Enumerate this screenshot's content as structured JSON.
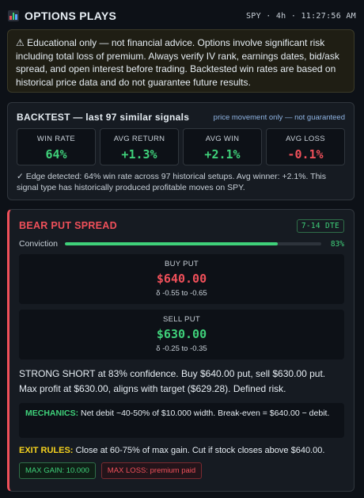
{
  "header": {
    "title": "OPTIONS PLAYS",
    "meta": "SPY · 4h · 11:27:56 AM",
    "icon": "bar-chart-icon"
  },
  "disclaimer": {
    "text": "⚠ Educational only — not financial advice. Options involve significant risk including total loss of premium. Always verify IV rank, earnings dates, bid/ask spread, and open interest before trading. Backtested win rates are based on historical price data and do not guarantee future results."
  },
  "backtest": {
    "title": "BACKTEST — last 97 similar signals",
    "note": "price movement only — not guaranteed",
    "stats": [
      {
        "label": "WIN RATE",
        "value": "64%"
      },
      {
        "label": "AVG RETURN",
        "value": "+1.3%"
      },
      {
        "label": "AVG WIN",
        "value": "+2.1%"
      },
      {
        "label": "AVG LOSS",
        "value": "-0.1%"
      }
    ],
    "edge_text": "✓ Edge detected: 64% win rate across 97 historical setups. Avg winner: +2.1%. This signal type has historically produced profitable moves on SPY."
  },
  "spread": {
    "title": "BEAR PUT SPREAD",
    "dte": "7-14 DTE",
    "conviction_label": "Conviction",
    "conviction_pct": "83%",
    "conviction_value": 0.83,
    "legs": [
      {
        "label": "BUY PUT",
        "price": "$640.00",
        "delta": "δ -0.55 to -0.65"
      },
      {
        "label": "SELL PUT",
        "price": "$630.00",
        "delta": "δ -0.25 to -0.35"
      }
    ],
    "summary": "STRONG SHORT at 83% confidence. Buy $640.00 put, sell $630.00 put. Max profit at $630.00, aligns with target ($629.28). Defined risk.",
    "mechanics_label": "MECHANICS:",
    "mechanics_text": " Net debit ~40-50% of $10.000 width. Break-even = $640.00 − debit.",
    "exit_label": "EXIT RULES:",
    "exit_text": " Close at 60-75% of max gain. Cut if stock closes above $640.00.",
    "max_gain": "MAX GAIN: 10.000",
    "max_loss": "MAX LOSS: premium paid"
  },
  "colors": {
    "bg": "#0d1117",
    "green": "#3fd17a",
    "red": "#f0505a",
    "yellow": "#f5d21e"
  }
}
